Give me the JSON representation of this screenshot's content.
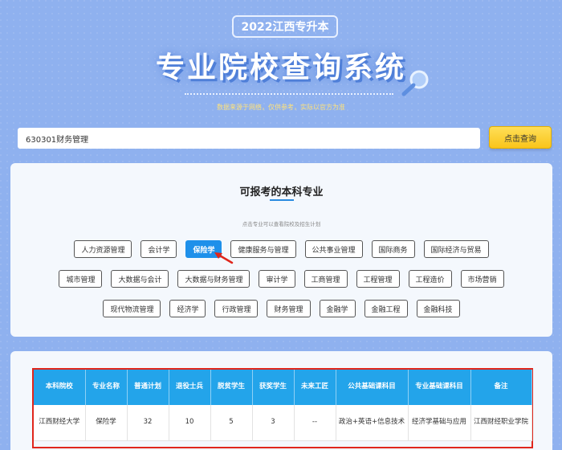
{
  "header": {
    "badge": "2022江西专升本",
    "title": "专业院校查询系统",
    "source_note": "数据来源于网络，仅供参考，实际以官方为准"
  },
  "search": {
    "value": "630301财务管理",
    "button_label": "点击查询"
  },
  "majors_panel": {
    "title": "可报考的本科专业",
    "hint": "点击专业可以查看院校及招生计划",
    "rows": [
      [
        "人力资源管理",
        "会计学",
        "保险学",
        "健康服务与管理",
        "公共事业管理",
        "国际商务",
        "国际经济与贸易"
      ],
      [
        "城市管理",
        "大数据与会计",
        "大数据与财务管理",
        "审计学",
        "工商管理",
        "工程管理",
        "工程造价",
        "市场营销"
      ],
      [
        "现代物流管理",
        "经济学",
        "行政管理",
        "财务管理",
        "金融学",
        "金融工程",
        "金融科技"
      ]
    ],
    "selected": "保险学"
  },
  "results_table": {
    "headers": [
      "本科院校",
      "专业名称",
      "普通计划",
      "退役士兵",
      "脱贫学生",
      "获奖学生",
      "未来工匠",
      "公共基础课科目",
      "专业基础课科目",
      "备注"
    ],
    "rows": [
      [
        "江西财经大学",
        "保险学",
        "32",
        "10",
        "5",
        "3",
        "--",
        "政治+英语+信息技术",
        "经济学基础与应用",
        "江西财经职业学院"
      ]
    ]
  },
  "colors": {
    "background": "#8fb1ef",
    "accent_blue": "#1e90ea",
    "table_header": "#23a4ea",
    "button_yellow": "#f9c51b",
    "highlight_red": "#e0261c"
  }
}
